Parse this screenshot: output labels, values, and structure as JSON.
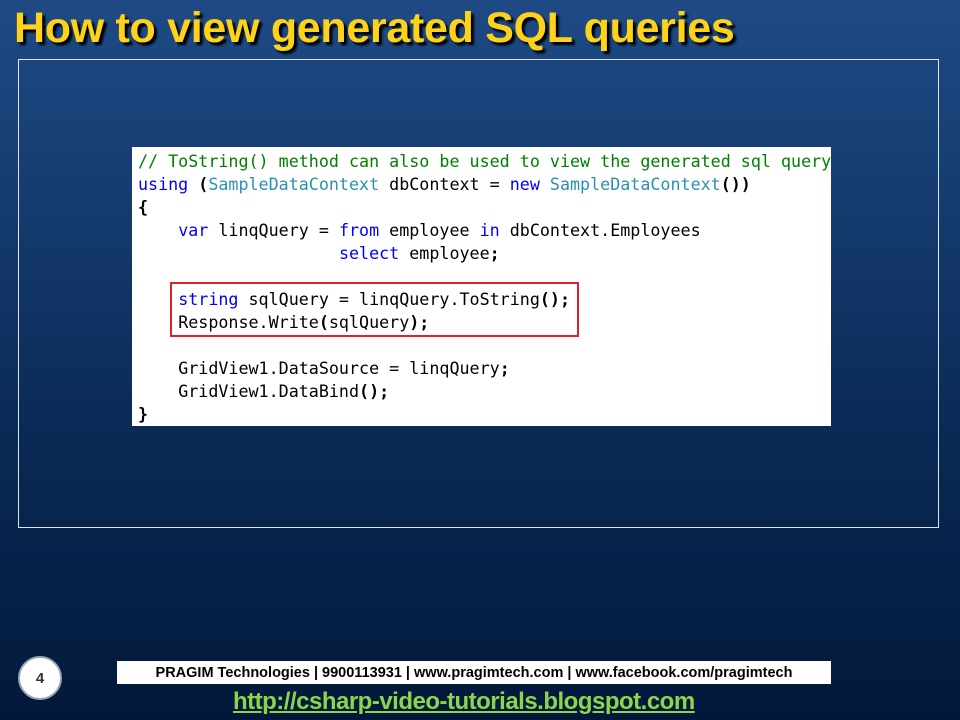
{
  "slide": {
    "title": "How to view generated SQL queries",
    "page_number": "4"
  },
  "code": {
    "line1": {
      "comment": "// ToString() method can also be used to view the generated sql query"
    },
    "line2": {
      "kw_using": "using",
      "p1": "(",
      "type1": "SampleDataContext",
      "t1": " dbContext = ",
      "kw_new": "new",
      "t2": " ",
      "type2": "SampleDataContext",
      "p2": "())"
    },
    "line3": {
      "p": "{"
    },
    "line4": {
      "indent": "    ",
      "kw_var": "var",
      "t1": " linqQuery = ",
      "kw_from": "from",
      "t2": " employee ",
      "kw_in": "in",
      "t3": " dbContext.Employees"
    },
    "line5": {
      "indent": "                    ",
      "kw_select": "select",
      "t1": " employee",
      "p": ";"
    },
    "line6": {
      "text": ""
    },
    "line7": {
      "indent": "    ",
      "kw_string": "string",
      "t1": " sqlQuery = linqQuery.ToString",
      "p": "();"
    },
    "line8": {
      "indent": "    ",
      "t1": "Response.Write",
      "p1": "(",
      "t2": "sqlQuery",
      "p2": ");"
    },
    "line9": {
      "text": ""
    },
    "line10": {
      "indent": "    ",
      "t1": "GridView1.DataSource = linqQuery",
      "p": ";"
    },
    "line11": {
      "indent": "    ",
      "t1": "GridView1.DataBind",
      "p": "();"
    },
    "line12": {
      "p": "}"
    }
  },
  "footer": {
    "company": "PRAGIM Technologies | 9900113931 | www.pragimtech.com | www.facebook.com/pragimtech",
    "link": "http://csharp-video-tutorials.blogspot.com"
  },
  "colors": {
    "title": "#ffd21a",
    "comment": "#008000",
    "keyword": "#0000ff",
    "type": "#2b91af",
    "highlight_border": "#e0202a",
    "footer_link": "#8ed44a"
  }
}
